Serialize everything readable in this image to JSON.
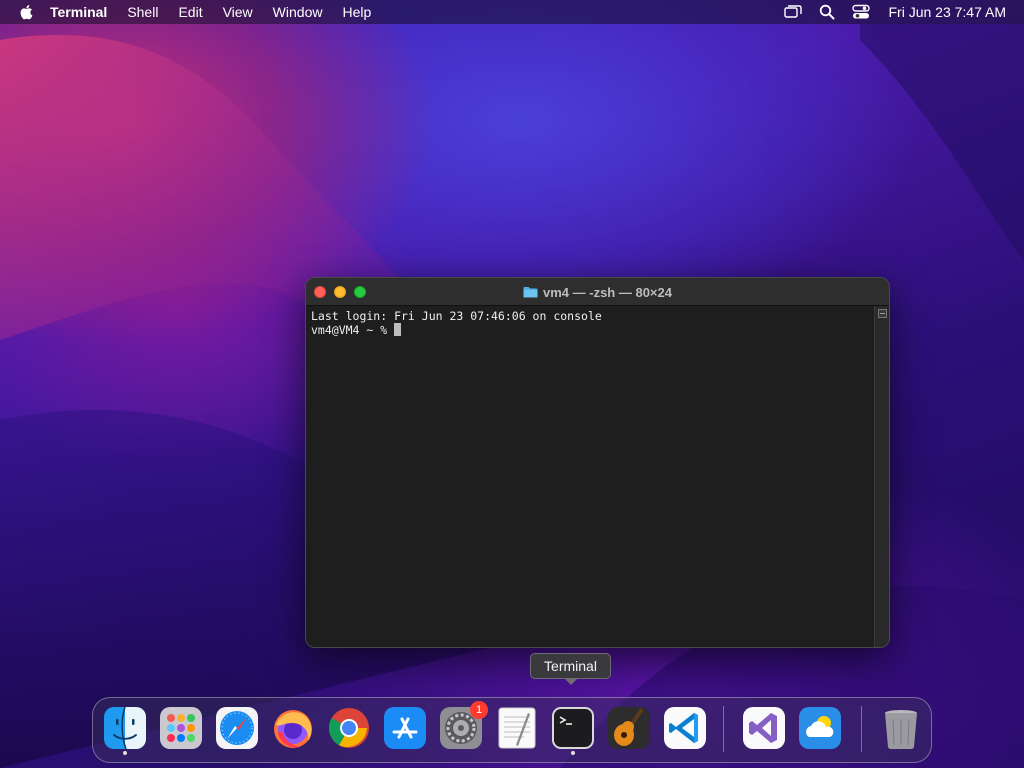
{
  "menubar": {
    "app_name": "Terminal",
    "items": [
      "Shell",
      "Edit",
      "View",
      "Window",
      "Help"
    ],
    "clock": "Fri Jun 23  7:47 AM",
    "status_icons": [
      "screen-mirroring-icon",
      "spotlight-search-icon",
      "control-center-icon"
    ]
  },
  "window": {
    "title": "vm4 — -zsh — 80×24",
    "lines": [
      "Last login: Fri Jun 23 07:46:06 on console",
      "vm4@VM4 ~ % "
    ]
  },
  "tooltip": {
    "text": "Terminal"
  },
  "dock": {
    "apps": [
      {
        "name": "Finder",
        "running": true
      },
      {
        "name": "Launchpad",
        "running": false
      },
      {
        "name": "Safari",
        "running": false
      },
      {
        "name": "Firefox",
        "running": false
      },
      {
        "name": "Google Chrome",
        "running": false
      },
      {
        "name": "App Store",
        "running": false
      },
      {
        "name": "System Preferences",
        "running": false,
        "badge": "1"
      },
      {
        "name": "TextEdit",
        "running": false
      },
      {
        "name": "Terminal",
        "running": true
      },
      {
        "name": "GarageBand",
        "running": false
      },
      {
        "name": "Visual Studio Code",
        "running": false
      },
      {
        "name": "Visual Studio",
        "running": false
      },
      {
        "name": "Weather",
        "running": false
      },
      {
        "name": "Trash",
        "running": false
      }
    ]
  },
  "colors": {
    "close": "#fe5f57",
    "minimize": "#febc2e",
    "maximize": "#28c840",
    "terminal_bg": "#1e1e1e"
  }
}
